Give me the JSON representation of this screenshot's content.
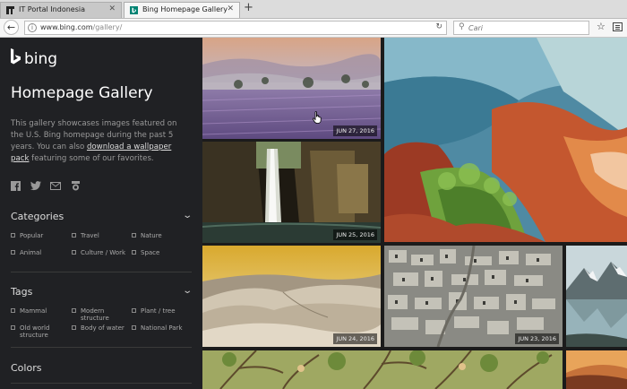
{
  "browser": {
    "tabs": [
      {
        "title": "IT Portal Indonesia",
        "active": false
      },
      {
        "title": "Bing Homepage Gallery",
        "active": true
      }
    ],
    "url_prefix": "www.bing.com",
    "url_path": "/gallery/",
    "search_placeholder": "Cari"
  },
  "sidebar": {
    "logo_text": "bing",
    "title": "Homepage Gallery",
    "desc_before": "This gallery showcases images featured on the U.S. Bing homepage during the past 5 years. You can also ",
    "desc_link": "download a wallpaper pack",
    "desc_after": " featuring some of our favorites.",
    "social_icons": [
      "facebook-icon",
      "twitter-icon",
      "email-icon",
      "rewards-icon"
    ],
    "categories": {
      "heading": "Categories",
      "items": [
        "Popular",
        "Travel",
        "Nature",
        "Animal",
        "Culture / Work",
        "Space"
      ]
    },
    "tags": {
      "heading": "Tags",
      "items": [
        {
          "l1": "Mammal",
          "l2": ""
        },
        {
          "l1": "Modern",
          "l2": "structure"
        },
        {
          "l1": "Plant / tree",
          "l2": ""
        },
        {
          "l1": "Old world",
          "l2": "structure"
        },
        {
          "l1": "Body of water",
          "l2": ""
        },
        {
          "l1": "National Park",
          "l2": ""
        }
      ]
    },
    "colors_heading": "Colors"
  },
  "gallery": {
    "tiles": [
      {
        "date": "JUN 27, 2016"
      },
      {
        "date": "JUN 25, 2016"
      },
      {
        "date": "JUN 24, 2016"
      },
      {
        "date": "JUN 23, 2016"
      },
      {
        "date": ""
      },
      {
        "date": ""
      },
      {
        "date": ""
      },
      {
        "date": ""
      }
    ]
  },
  "colors": {
    "sidebar_bg": "#202124",
    "tab_active": "#f6f6f6",
    "bing_logo": "#ffffff"
  }
}
